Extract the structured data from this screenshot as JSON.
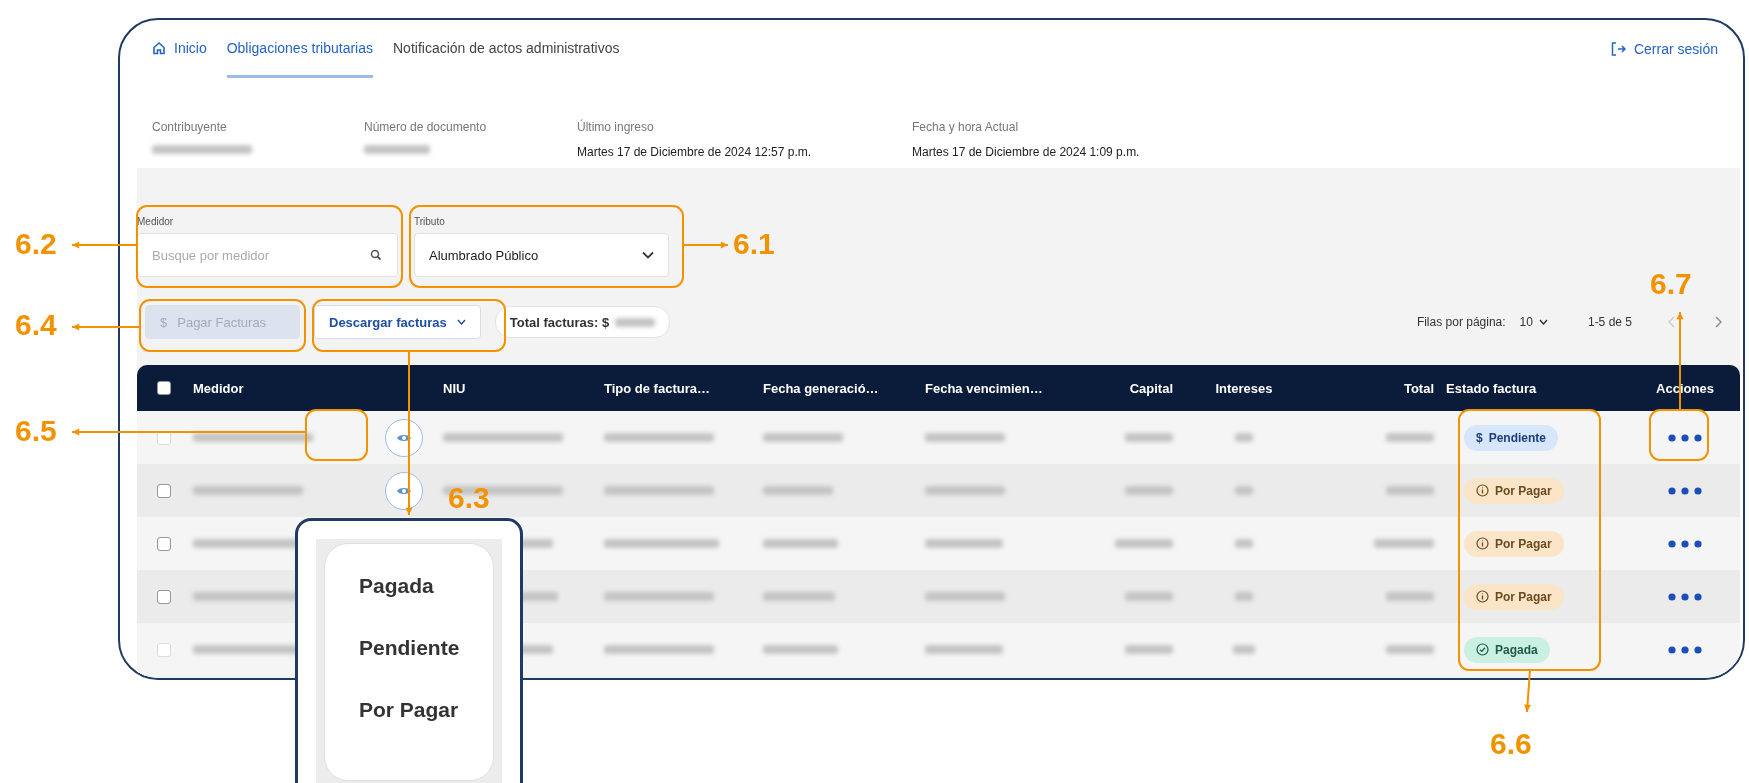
{
  "nav": {
    "tabs": [
      {
        "label": "Inicio",
        "kind": "home",
        "selected": false
      },
      {
        "label": "Obligaciones tributarias",
        "kind": "tab",
        "selected": true
      },
      {
        "label": "Notificación de actos administrativos",
        "kind": "tab",
        "selected": false
      }
    ],
    "logout": "Cerrar sesión"
  },
  "info": [
    {
      "label": "Contribuyente"
    },
    {
      "label": "Número de documento"
    },
    {
      "label": "Último ingreso",
      "value": "Martes 17 de Diciembre de 2024 12:57 p.m."
    },
    {
      "label": "Fecha y hora Actual",
      "value": "Martes 17 de Diciembre de 2024 1:09 p.m."
    }
  ],
  "filters": {
    "medidor": {
      "label": "Medidor",
      "placeholder": "Busque por medidor"
    },
    "tributo": {
      "label": "Tributo",
      "value": "Alumbrado Público"
    }
  },
  "actions": {
    "pay": {
      "icon": "$",
      "label": "Pagar Facturas",
      "disabled": true
    },
    "download": {
      "label": "Descargar facturas"
    },
    "total_label": "Total facturas: $"
  },
  "pagination": {
    "rows_label": "Filas por página:",
    "rows_value": "10",
    "range": "1-5 de 5",
    "prev_disabled": true
  },
  "table": {
    "header_checked": false,
    "columns": [
      "Medidor",
      "NIU",
      "Tipo de factura…",
      "Fecha generació…",
      "Fecha vencimien…",
      "Capital",
      "Intereses",
      "Total",
      "Estado factura",
      "Acciones"
    ],
    "rows": [
      {
        "checkbox_disabled": true,
        "checked": false,
        "view_button": true,
        "status": {
          "kind": "pending",
          "icon": "$",
          "label": "Pendiente"
        }
      },
      {
        "checkbox_disabled": false,
        "checked": false,
        "view_button": true,
        "status": {
          "kind": "due",
          "label": "Por Pagar"
        }
      },
      {
        "checkbox_disabled": false,
        "checked": false,
        "status": {
          "kind": "due",
          "label": "Por Pagar"
        }
      },
      {
        "checkbox_disabled": false,
        "checked": false,
        "status": {
          "kind": "due",
          "label": "Por Pagar"
        }
      },
      {
        "checkbox_disabled": true,
        "checked": false,
        "status": {
          "kind": "paid",
          "label": "Pagada"
        }
      }
    ]
  },
  "popup": {
    "items": [
      "Pagada",
      "Pendiente",
      "Por Pagar"
    ]
  },
  "annotations": [
    {
      "label": "6.2"
    },
    {
      "label": "6.1"
    },
    {
      "label": "6.7"
    },
    {
      "label": "6.4"
    },
    {
      "label": "6.5"
    },
    {
      "label": "6.3"
    },
    {
      "label": "6.6"
    }
  ]
}
